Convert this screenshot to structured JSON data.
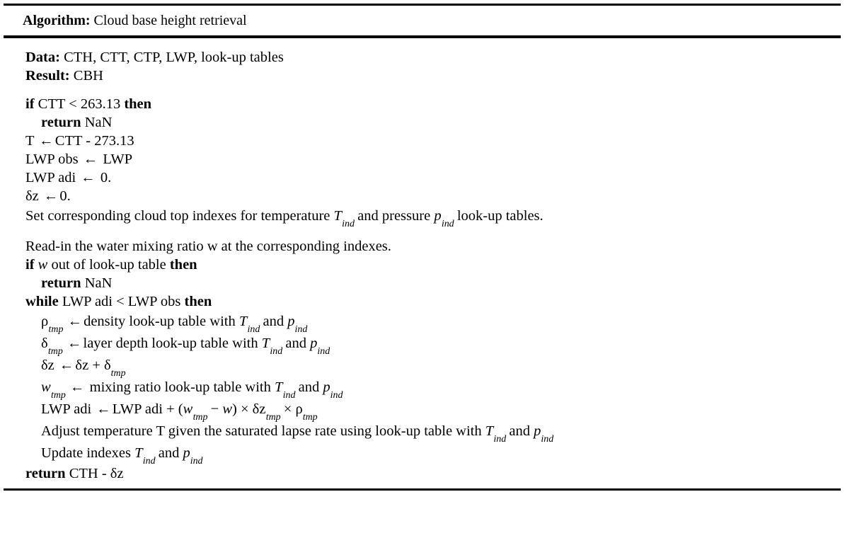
{
  "header": {
    "keyword": "Algorithm:",
    "title": "Cloud base height retrieval"
  },
  "io": {
    "data_label": "Data:",
    "data_value": "CTH, CTT, CTP, LWP, look-up tables",
    "result_label": "Result:",
    "result_value": "CBH"
  },
  "keywords": {
    "if": "if",
    "then": "then",
    "return": "return",
    "while": "while"
  },
  "symbols": {
    "arrow": "←",
    "delta": "δ",
    "rho": "ρ",
    "times": "×",
    "minus": "−",
    "less_than": "<",
    "sub_ind": "ind",
    "sub_tmp": "tmp"
  },
  "lines": {
    "l1_cond": "CTT < 263.13",
    "l2_nan": "NaN",
    "l3_assign_T_lhs": "T",
    "l3_assign_T_rhs": "CTT - 273.13",
    "l4_lhs": "LWP obs",
    "l4_rhs": "LWP",
    "l5_lhs": "LWP adi",
    "l5_rhs": "0.",
    "l6_lhs_var": "z",
    "l6_rhs": "0.",
    "l7_a": "Set corresponding cloud top indexes for temperature",
    "l7_b": "and pressure",
    "l7_c": "look-up tables.",
    "l8": "Read-in the water mixing ratio w at the corresponding indexes.",
    "l9_a": "w",
    "l9_b": "out of look-up table",
    "l10_nan": "NaN",
    "l11_cond": "LWP adi < LWP obs",
    "l12_a": "density look-up table with",
    "l12_b": "and",
    "l13_a": "layer depth look-up table with",
    "l13_b": "and",
    "l14_var": "z",
    "l15_a": "mixing ratio look-up table with",
    "l15_b": "and",
    "l16_lhs": "LWP adi",
    "l16_rhs_head": "LWP adi + (",
    "l16_w": "w",
    "l16_close": ")",
    "l17": "Adjust temperature T given the saturated lapse rate using look-up table with",
    "l17_b": "and",
    "l18_a": "Update indexes",
    "l18_b": "and",
    "l19_rhs": "CTH -",
    "l19_var": "z"
  }
}
